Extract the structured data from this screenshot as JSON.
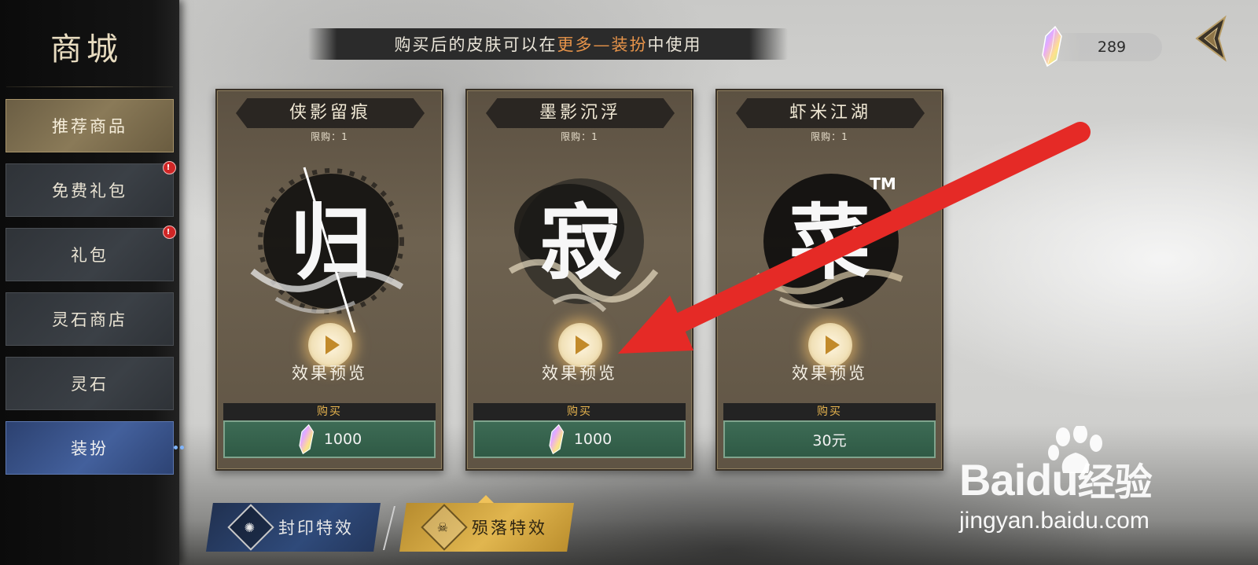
{
  "sidebar": {
    "title": "商城",
    "items": [
      {
        "label": "推荐商品",
        "state": "highlighted",
        "badge": false
      },
      {
        "label": "免费礼包",
        "state": "normal",
        "badge": true
      },
      {
        "label": "礼包",
        "state": "normal",
        "badge": true
      },
      {
        "label": "灵石商店",
        "state": "normal",
        "badge": false
      },
      {
        "label": "灵石",
        "state": "normal",
        "badge": false
      },
      {
        "label": "装扮",
        "state": "selected",
        "badge": false
      }
    ],
    "badge_text": "!"
  },
  "banner": {
    "prefix": "购买后的皮肤可以在",
    "highlight": "更多—装扮",
    "suffix": "中使用"
  },
  "currency": {
    "amount": "289",
    "icon": "crystal-gem-icon"
  },
  "products": [
    {
      "name": "侠影留痕",
      "limit": "限购：1",
      "art_char": "归",
      "preview": "效果预览",
      "buy": "购买",
      "price": "1000",
      "price_icon": "crystal-gem-icon"
    },
    {
      "name": "墨影沉浮",
      "limit": "限购：1",
      "art_char": "寂",
      "preview": "效果预览",
      "buy": "购买",
      "price": "1000",
      "price_icon": "crystal-gem-icon"
    },
    {
      "name": "虾米江湖",
      "limit": "限购：1",
      "art_char": "菜",
      "preview": "效果预览",
      "buy": "购买",
      "price": "30元",
      "price_icon": null
    }
  ],
  "bottom_tabs": [
    {
      "label": "封印特效",
      "icon": "seal-emblem-icon",
      "active": false
    },
    {
      "label": "殒落特效",
      "icon": "skull-emblem-icon",
      "active": true
    }
  ],
  "art_superscript": "TM",
  "overlay": {
    "annotation": "red-arrow",
    "color": "#e52a26"
  },
  "watermark": {
    "brand_latin": "Bai",
    "brand_latin2": "du",
    "brand_cn": "经验",
    "url": "jingyan.baidu.com"
  },
  "colors": {
    "highlight_orange": "#e8944a",
    "buy_gold": "#e6b34e",
    "price_green": "#2f5a45",
    "selected_blue": "#43609c",
    "active_tab_gold": "#e1b64f"
  }
}
